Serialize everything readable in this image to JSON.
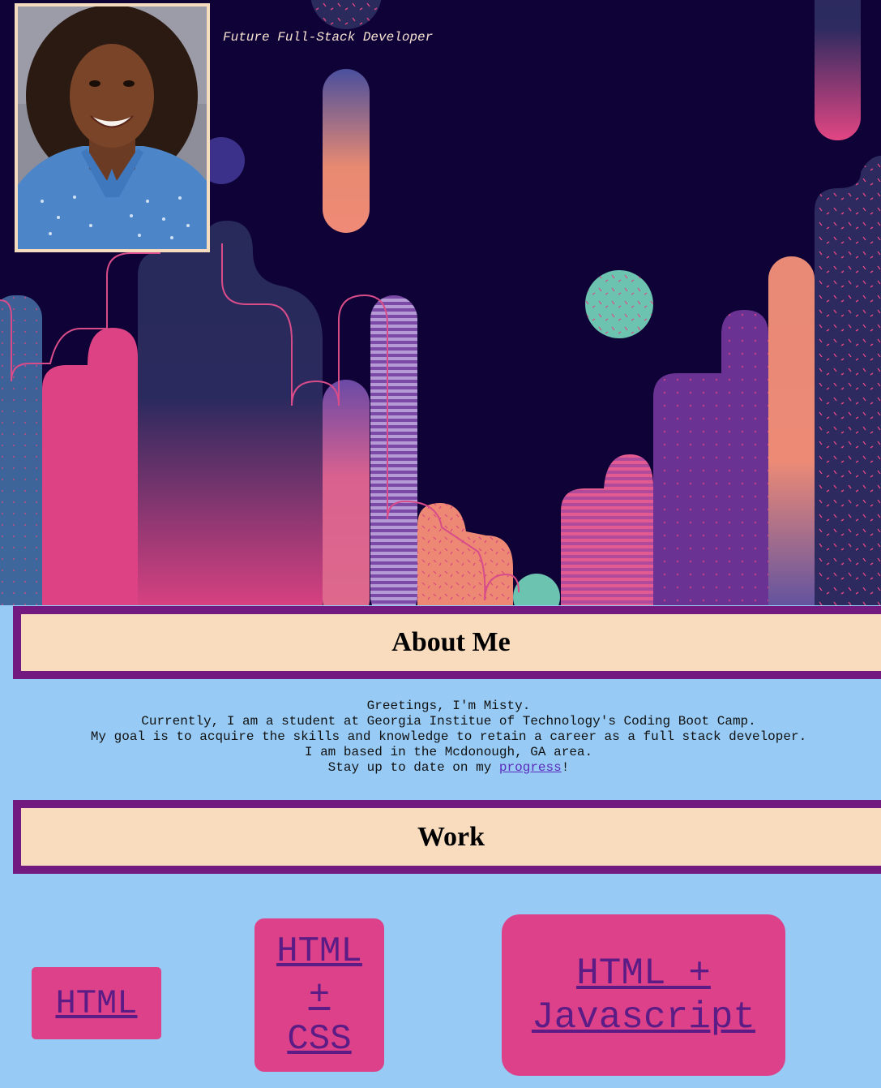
{
  "header": {
    "tagline": "Future Full-Stack Developer",
    "portrait_alt": "Portrait of Misty"
  },
  "about": {
    "heading": "About Me",
    "lines": [
      "Greetings, I'm Misty.",
      "Currently, I am a student at Georgia Institue of Technology's Coding Boot Camp.",
      "My goal is to acquire the skills and knowledge to retain a career as a full stack developer.",
      "I am based in the Mcdonough, GA area."
    ],
    "progress_prefix": "Stay up to date on my ",
    "progress_link": "progress",
    "progress_suffix": "!"
  },
  "work": {
    "heading": "Work",
    "projects": [
      {
        "label": "HTML"
      },
      {
        "label": "HTML + CSS"
      },
      {
        "label": "HTML + Javascript"
      }
    ]
  },
  "colors": {
    "page_background": "#97cbf5",
    "hero_background": "#0e0236",
    "banner_fill": "#f9dbbd",
    "banner_border": "#721a7f",
    "card_fill": "#dc4189",
    "link": "#5b2bbd"
  }
}
